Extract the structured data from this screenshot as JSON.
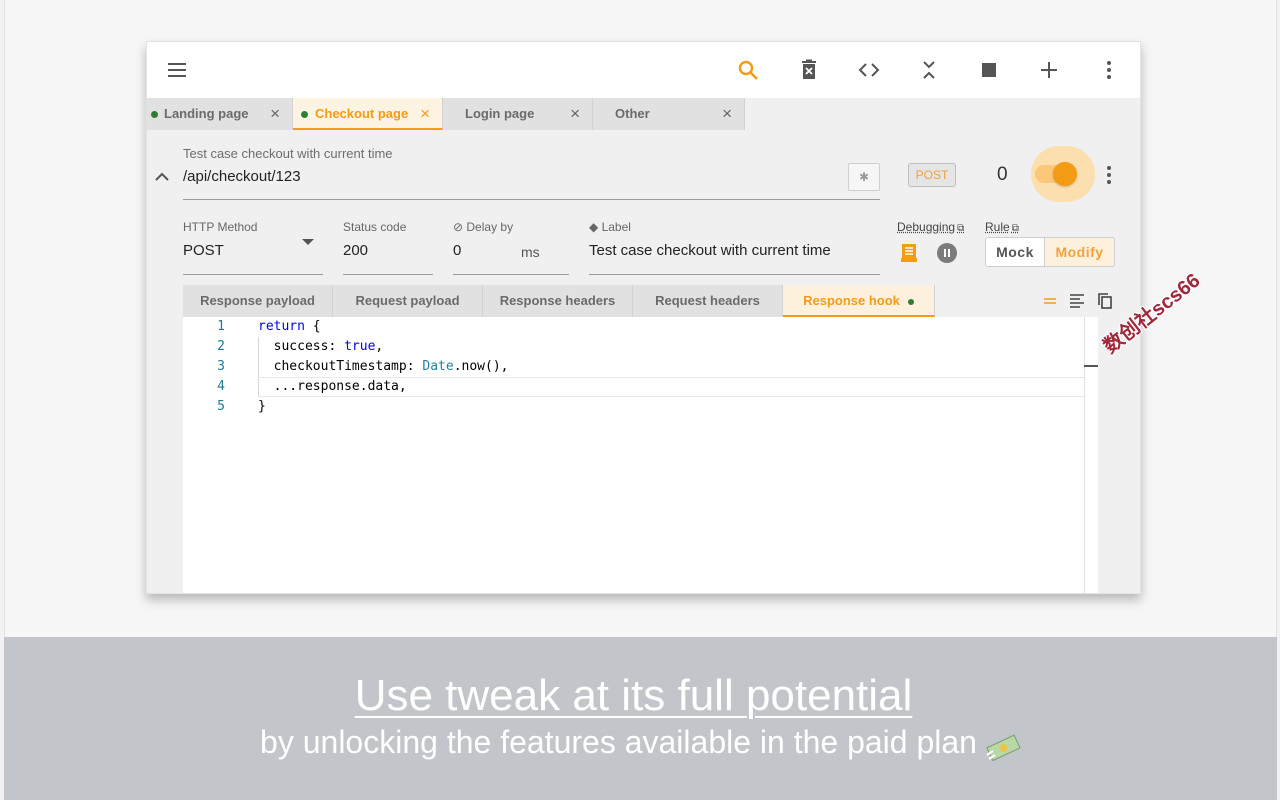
{
  "toolbar": {
    "icons": [
      "menu-icon",
      "search-icon",
      "delete-icon",
      "code-icon",
      "collapse-icon",
      "stop-icon",
      "add-icon",
      "more-icon"
    ],
    "accent": "#f49c16"
  },
  "tabs": [
    {
      "label": "Landing page",
      "close": "×",
      "has_dot": true
    },
    {
      "label": "Checkout page",
      "close": "×",
      "has_dot": true,
      "active": true
    },
    {
      "label": "Login page",
      "close": "×",
      "has_dot": false
    },
    {
      "label": "Other",
      "close": "×",
      "has_dot": false
    }
  ],
  "request": {
    "hint": "Test case checkout with current time",
    "url": "/api/checkout/123",
    "method_badge": "POST",
    "count": "0",
    "enabled": true
  },
  "fields": {
    "method_label": "HTTP Method",
    "method_value": "POST",
    "status_label": "Status code",
    "status_value": "200",
    "delay_label": "Delay by",
    "delay_value": "0",
    "delay_unit": "ms",
    "label_label": "Label",
    "label_value": "Test case checkout with current time",
    "debugging_label": "Debugging",
    "rule_label": "Rule",
    "mock_label": "Mock",
    "modify_label": "Modify"
  },
  "response_tabs": [
    {
      "label": "Response payload"
    },
    {
      "label": "Request payload"
    },
    {
      "label": "Response headers"
    },
    {
      "label": "Request headers"
    },
    {
      "label": "Response hook",
      "active": true
    }
  ],
  "editor": {
    "line_numbers": [
      "1",
      "2",
      "3",
      "4",
      "5"
    ],
    "lines": [
      {
        "parts": [
          {
            "t": "return",
            "c": "kw"
          },
          {
            "t": " {",
            "c": ""
          }
        ]
      },
      {
        "parts": [
          {
            "t": "  success: ",
            "c": ""
          },
          {
            "t": "true",
            "c": "kw"
          },
          {
            "t": ",",
            "c": ""
          }
        ]
      },
      {
        "parts": [
          {
            "t": "  checkoutTimestamp: ",
            "c": ""
          },
          {
            "t": "Date",
            "c": "ty"
          },
          {
            "t": ".now(),",
            "c": ""
          }
        ]
      },
      {
        "parts": [
          {
            "t": "  ...response.data,",
            "c": ""
          }
        ]
      },
      {
        "parts": [
          {
            "t": "}",
            "c": ""
          }
        ]
      }
    ]
  },
  "watermark": "数创社scs66",
  "banner": {
    "title": "Use tweak at its full potential",
    "subtitle": "by unlocking the features available in the paid plan"
  }
}
